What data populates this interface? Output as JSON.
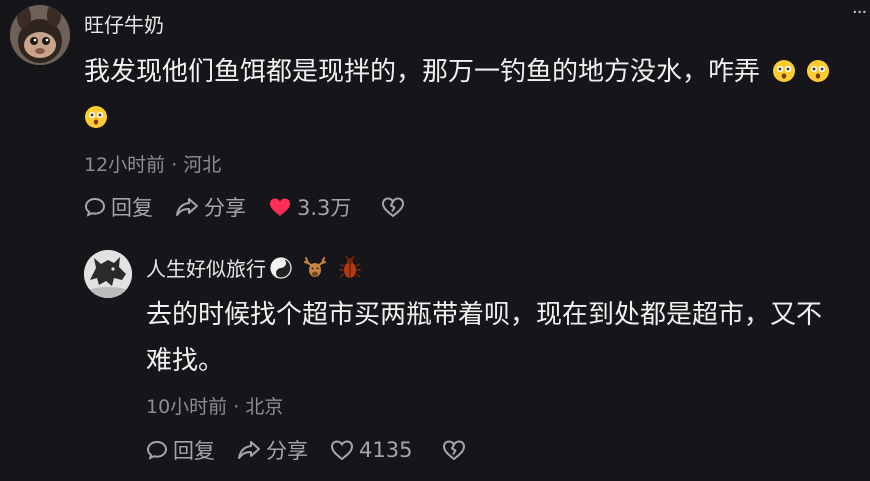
{
  "comment": {
    "username": "旺仔牛奶",
    "text": "我发现他们鱼饵都是现拌的，那万一钓鱼的地方没水，咋弄",
    "emoji_names": [
      "flushed-face-icon",
      "flushed-face-icon",
      "flushed-face-icon"
    ],
    "meta": "12小时前 · 河北",
    "reply_label": "回复",
    "share_label": "分享",
    "likes": "3.3万",
    "liked": true
  },
  "reply": {
    "username": "人生好似旅行",
    "badges": [
      "yin-yang-icon",
      "deer-icon",
      "beetle-icon"
    ],
    "text": "去的时候找个超市买两瓶带着呗，现在到处都是超市，又不难找。",
    "meta": "10小时前 · 北京",
    "reply_label": "回复",
    "share_label": "分享",
    "likes": "4135",
    "liked": false
  },
  "colors": {
    "background": "#16161a",
    "text": "#f0f0f0",
    "muted": "#8c8c92",
    "like_active": "#ff2d55"
  }
}
